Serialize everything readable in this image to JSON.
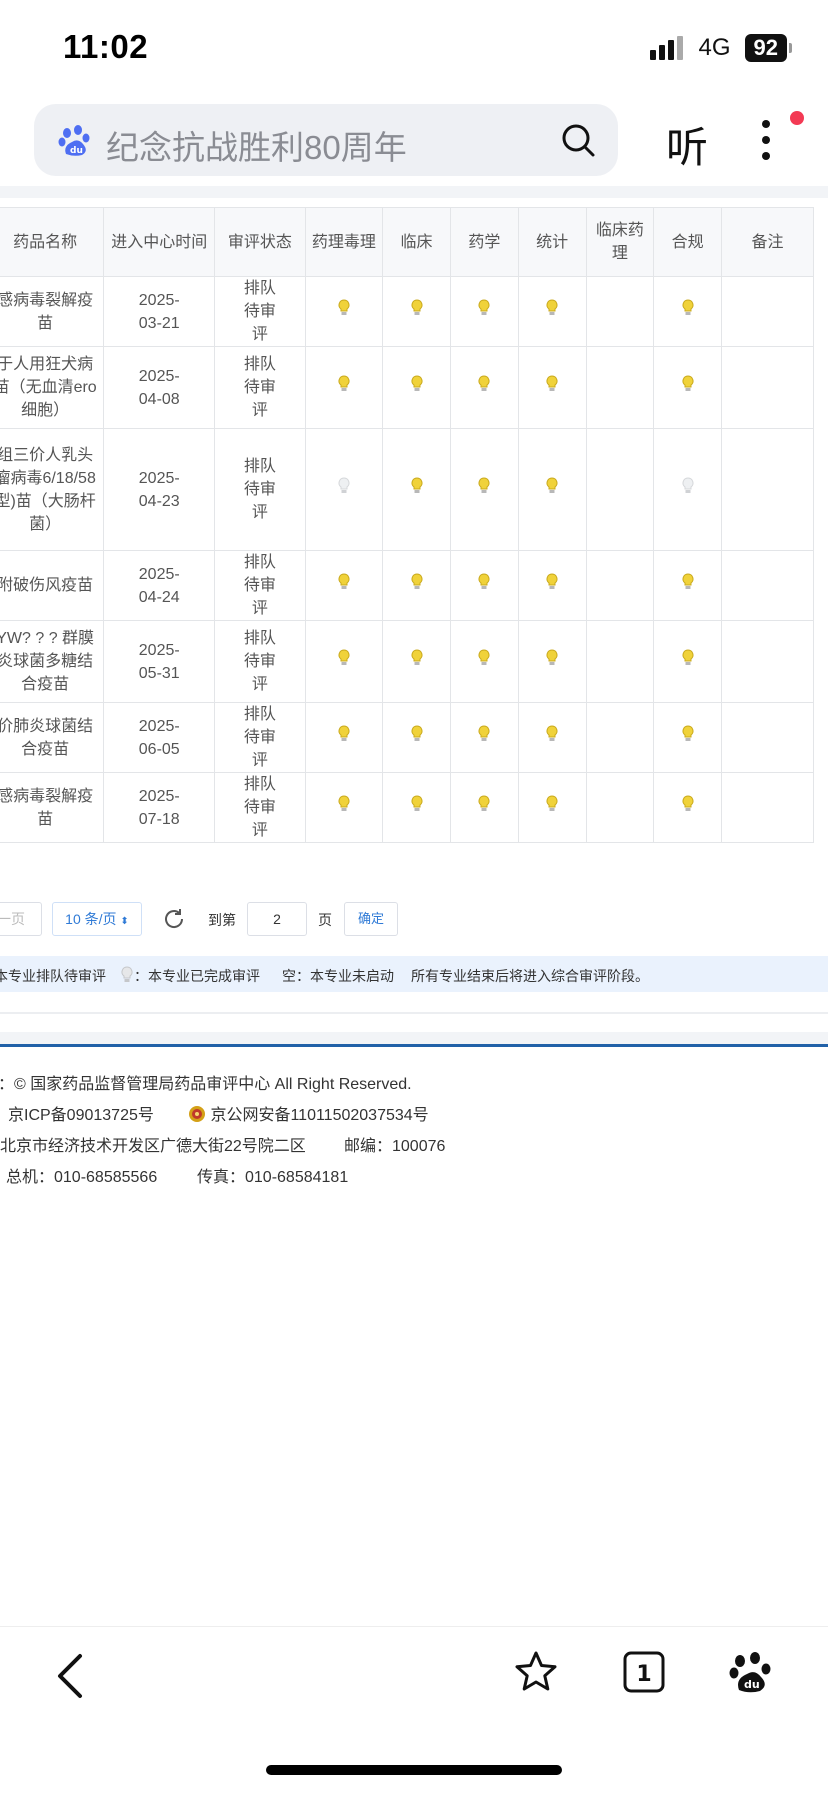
{
  "status_bar": {
    "time": "11:02",
    "network": "4G",
    "battery": "92"
  },
  "search": {
    "query": "纪念抗战胜利80周年"
  },
  "header": {
    "listen_label": "听"
  },
  "table": {
    "headers": [
      "药品名称",
      "进入中心时间",
      "审评状态",
      "药理毒理",
      "临床",
      "药学",
      "统计",
      "临床药理",
      "合规",
      "备注"
    ],
    "rows": [
      {
        "name": "感病毒裂解疫苗",
        "date": "2025-03-21",
        "status": "排队待审评",
        "marks": [
          "on",
          "on",
          "on",
          "on",
          "",
          "on",
          ""
        ]
      },
      {
        "name": "于人用狂犬病苗（无血清ero细胞）",
        "date": "2025-04-08",
        "status": "排队待审评",
        "marks": [
          "on",
          "on",
          "on",
          "on",
          "",
          "on",
          ""
        ]
      },
      {
        "name": "组三价人乳头瘤病毒6/18/58型)苗（大肠杆菌）",
        "date": "2025-04-23",
        "status": "排队待审评",
        "marks": [
          "off",
          "on",
          "on",
          "on",
          "",
          "off",
          ""
        ]
      },
      {
        "name": "附破伤风疫苗",
        "date": "2025-04-24",
        "status": "排队待审评",
        "marks": [
          "on",
          "on",
          "on",
          "on",
          "",
          "on",
          ""
        ]
      },
      {
        "name": "YW? ? ? 群膜炎球菌多糖结合疫苗",
        "date": "2025-05-31",
        "status": "排队待审评",
        "marks": [
          "on",
          "on",
          "on",
          "on",
          "",
          "on",
          ""
        ]
      },
      {
        "name": "价肺炎球菌结合疫苗",
        "date": "2025-06-05",
        "status": "排队待审评",
        "marks": [
          "on",
          "on",
          "on",
          "on",
          "",
          "on",
          ""
        ]
      },
      {
        "name": "感病毒裂解疫苗",
        "date": "2025-07-18",
        "status": "排队待审评",
        "marks": [
          "on",
          "on",
          "on",
          "on",
          "",
          "on",
          ""
        ]
      }
    ]
  },
  "pagination": {
    "prev_label": "一页",
    "page_size": "10 条/页",
    "goto_label": "到第",
    "goto_value": "2",
    "page_unit": "页",
    "confirm_label": "确定"
  },
  "legend": {
    "queued": "本专业排队待审评",
    "done": "：本专业已完成审评",
    "empty": "空：本专业未启动",
    "note": "所有专业结束后将进入综合审评阶段。"
  },
  "footer": {
    "copyright": "：© 国家药品监督管理局药品审评中心   All Right Reserved.",
    "icp": "京ICP备09013725号",
    "police": "京公网安备11011502037534号",
    "address": "北京市经济技术开发区广德大街22号院二区",
    "postcode": "邮编：100076",
    "phone": "总机：010-68585566",
    "fax": "传真：010-68584181"
  },
  "colors": {
    "accent": "#2f7ad6",
    "bulb_on": "#f0d23a",
    "bulb_off": "#d5d7da",
    "footer_line": "#2161a8"
  },
  "icons": [
    "baidu-paw-icon",
    "search-icon",
    "more-icon",
    "refresh-icon",
    "police-badge-icon",
    "back-icon",
    "star-icon",
    "tabs-icon"
  ]
}
